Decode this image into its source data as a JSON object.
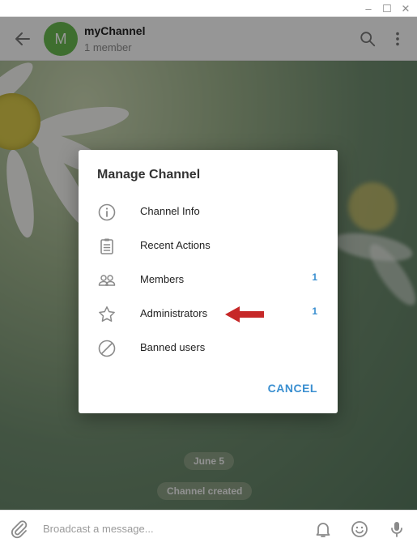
{
  "window": {
    "minimize_glyph": "‒",
    "maximize_glyph": "☐",
    "close_glyph": "✕"
  },
  "header": {
    "avatar_letter": "M",
    "avatar_color": "#68b84f",
    "channel_name": "myChannel",
    "subtitle": "1 member"
  },
  "chat": {
    "date_label": "June 5",
    "system_message": "Channel created"
  },
  "dialog": {
    "title": "Manage Channel",
    "items": [
      {
        "label": "Channel Info",
        "icon": "info-icon",
        "count": ""
      },
      {
        "label": "Recent Actions",
        "icon": "clipboard-icon",
        "count": ""
      },
      {
        "label": "Members",
        "icon": "members-icon",
        "count": "1"
      },
      {
        "label": "Administrators",
        "icon": "star-icon",
        "count": "1"
      },
      {
        "label": "Banned users",
        "icon": "ban-icon",
        "count": ""
      }
    ],
    "cancel_label": "CANCEL",
    "accent_color": "#3a8fd0"
  },
  "annotation": {
    "arrow_color": "#c62828",
    "points_to": "Administrators"
  },
  "composer": {
    "placeholder": "Broadcast a message..."
  }
}
